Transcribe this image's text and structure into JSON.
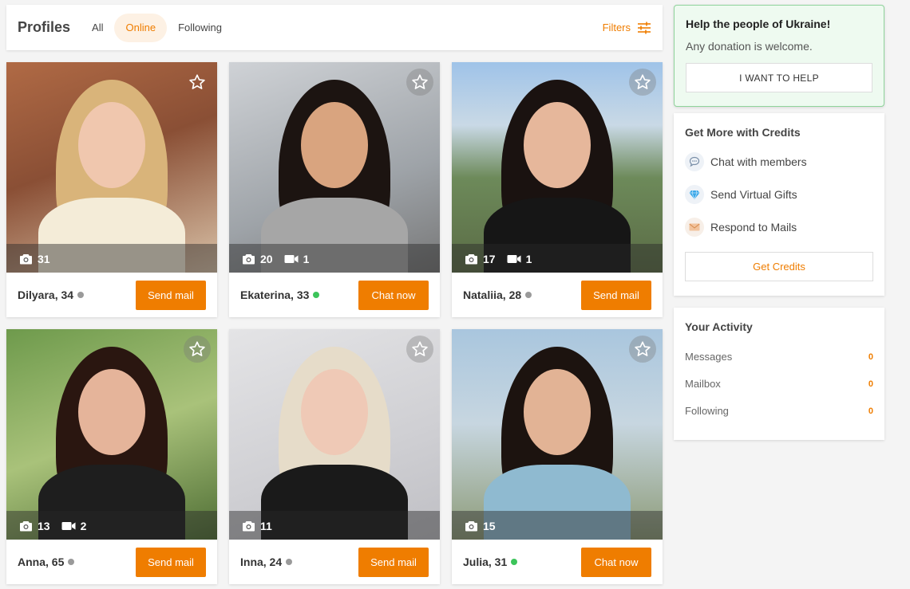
{
  "header": {
    "title": "Profiles",
    "tabs": [
      "All",
      "Online",
      "Following"
    ],
    "active_tab": "Online",
    "filters_label": "Filters"
  },
  "profiles": [
    {
      "name": "Dilyara, 34",
      "online": false,
      "photos": "31",
      "videos": "",
      "action": "Send mail",
      "favorited_style": "plain"
    },
    {
      "name": "Ekaterina, 33",
      "online": true,
      "photos": "20",
      "videos": "1",
      "action": "Chat now",
      "favorited_style": "circle"
    },
    {
      "name": "Nataliia, 28",
      "online": false,
      "photos": "17",
      "videos": "1",
      "action": "Send mail",
      "favorited_style": "circle"
    },
    {
      "name": "Anna, 65",
      "online": false,
      "photos": "13",
      "videos": "2",
      "action": "Send mail",
      "favorited_style": "circle"
    },
    {
      "name": "Inna, 24",
      "online": false,
      "photos": "11",
      "videos": "",
      "action": "Send mail",
      "favorited_style": "circle"
    },
    {
      "name": "Julia, 31",
      "online": true,
      "photos": "15",
      "videos": "",
      "action": "Chat now",
      "favorited_style": "circle"
    }
  ],
  "ukraine": {
    "title": "Help the people of Ukraine!",
    "subtitle": "Any donation is welcome.",
    "button": "I WANT TO HELP"
  },
  "credits": {
    "title": "Get More with Credits",
    "items": [
      {
        "label": "Chat with members",
        "icon": "chat-bubble-icon"
      },
      {
        "label": "Send Virtual Gifts",
        "icon": "gift-diamond-icon"
      },
      {
        "label": "Respond to Mails",
        "icon": "envelope-icon"
      }
    ],
    "button": "Get Credits"
  },
  "activity": {
    "title": "Your Activity",
    "rows": [
      {
        "label": "Messages",
        "value": "0"
      },
      {
        "label": "Mailbox",
        "value": "0"
      },
      {
        "label": "Following",
        "value": "0"
      }
    ]
  },
  "colors": {
    "accent": "#ef7d00",
    "online": "#3cc45a",
    "offline": "#9a9a9a"
  }
}
